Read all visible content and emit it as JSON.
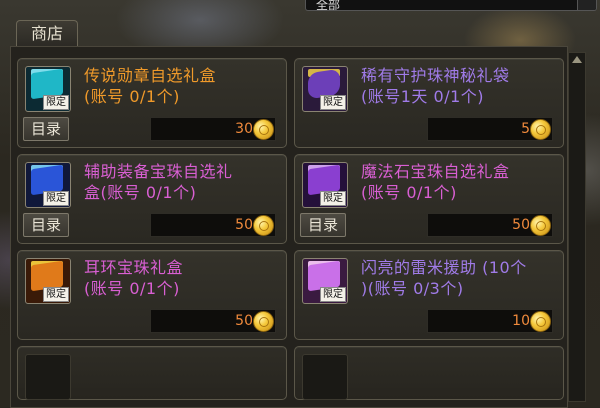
{
  "top_select": {
    "value": "全部"
  },
  "shop_tab": {
    "label": "商店"
  },
  "items": [
    {
      "title": "传说勋章自选礼盒",
      "limit": "(账号 0/1个)",
      "title_color": "#f09a2a",
      "tag": "限定",
      "price": "30",
      "catalog": "目录",
      "icon": "cyan-gift-box-icon",
      "box_color": "#1fb7c7",
      "lid_color": "#8cf0ff"
    },
    {
      "title": "稀有守护珠神秘礼袋",
      "limit": "(账号1天 0/1个)",
      "title_color": "#a07be8",
      "tag": "限定",
      "price": "5",
      "catalog": "",
      "icon": "purple-pouch-icon",
      "box_color": "#6c3fb8",
      "lid_color": "#e8c84a"
    },
    {
      "title": "辅助装备宝珠自选礼",
      "limit": "盒(账号 0/1个)",
      "title_color": "#d95fd3",
      "tag": "限定",
      "price": "50",
      "catalog": "目录",
      "icon": "blue-orb-box-icon",
      "box_color": "#2a55d8",
      "lid_color": "#7fd8ff"
    },
    {
      "title": "魔法石宝珠自选礼盒",
      "limit": "(账号 0/1个)",
      "title_color": "#d95fd3",
      "tag": "限定",
      "price": "50",
      "catalog": "目录",
      "icon": "magic-stone-box-icon",
      "box_color": "#8a3fd0",
      "lid_color": "#e0b0ff"
    },
    {
      "title": "耳环宝珠礼盒",
      "limit": "(账号 0/1个)",
      "title_color": "#d95fd3",
      "tag": "限定",
      "price": "50",
      "catalog": "",
      "icon": "orange-gift-box-icon",
      "box_color": "#e07a1a",
      "lid_color": "#ffd640"
    },
    {
      "title": "闪亮的雷米援助 (10个",
      "limit": ")(账号 0/3个)",
      "title_color": "#a07be8",
      "tag": "限定",
      "price": "10",
      "catalog": "",
      "icon": "pink-crystal-icon",
      "box_color": "#c970e8",
      "lid_color": "#ffd0ff"
    }
  ],
  "colors": {
    "price": "#f08a3c",
    "panel_bg": "#24221d",
    "card_border": "#5b5749"
  }
}
